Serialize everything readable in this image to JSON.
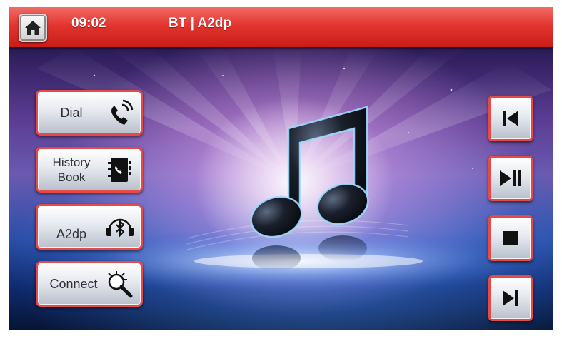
{
  "status_bar": {
    "home_icon": "home-icon",
    "time": "09:02",
    "title": "BT | A2dp"
  },
  "left_menu": [
    {
      "label": "Dial",
      "icon": "phone-icon"
    },
    {
      "label": "History\nBook",
      "icon": "contact-book-icon"
    },
    {
      "label": "A2dp",
      "icon": "bluetooth-headphones-icon"
    },
    {
      "label": "Connect",
      "icon": "magnifier-search-icon"
    }
  ],
  "controls": [
    {
      "action": "previous",
      "icon": "skip-previous-icon"
    },
    {
      "action": "play-pause",
      "icon": "play-pause-icon"
    },
    {
      "action": "stop",
      "icon": "stop-icon"
    },
    {
      "action": "next",
      "icon": "skip-next-icon"
    }
  ],
  "artwork": {
    "icon": "music-note-icon"
  },
  "colors": {
    "status_bar_red": "#e3352f",
    "button_border_red": "#e34a48",
    "button_face": "#e6e9ef"
  }
}
